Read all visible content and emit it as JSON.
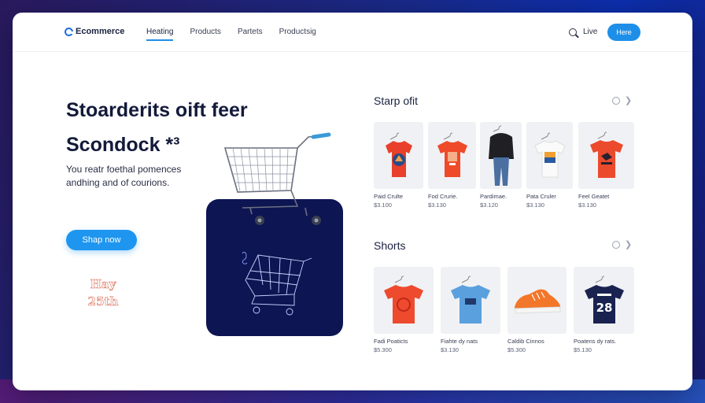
{
  "header": {
    "logo_text": "Ecommerce",
    "nav": [
      "Heating",
      "Products",
      "Partets",
      "Productsig"
    ],
    "active_nav": 0,
    "link": "Live",
    "button": "Here"
  },
  "hero": {
    "title_line1": "Stoarderits oift feer",
    "title_line2": "Scondock *³",
    "subtitle": "You reatr foethal pomences andhing and of courions.",
    "cta": "Shap now",
    "stamp_line1": "Hay",
    "stamp_line2": "25th"
  },
  "sections": [
    {
      "title": "Starp ofit",
      "products": [
        {
          "name": "Paid Crulte",
          "price": "$3.100",
          "icon": "red-graphic-tshirt"
        },
        {
          "name": "Fod Crurie.",
          "price": "$3.130",
          "icon": "orange-print-tshirt"
        },
        {
          "name": "Pardimae.",
          "price": "$3.120",
          "icon": "black-hoodie-jeans"
        },
        {
          "name": "Pata Cruler",
          "price": "$3.130",
          "icon": "white-photo-tshirt"
        },
        {
          "name": "Feel Geatet",
          "price": "$3.130",
          "icon": "red-bird-tshirt"
        }
      ]
    },
    {
      "title": "Shorts",
      "products": [
        {
          "name": "Fadi Poaticts",
          "price": "$5.300",
          "icon": "red-round-logo-tshirt"
        },
        {
          "name": "Fiahte dy nats",
          "price": "$3.130",
          "icon": "blue-print-tshirt"
        },
        {
          "name": "Caldib Cinnos",
          "price": "$5.300",
          "icon": "orange-sneaker"
        },
        {
          "name": "Poatens dy rats.",
          "price": "$5.130",
          "icon": "navy-28-jersey"
        }
      ]
    }
  ],
  "colors": {
    "accent": "#1e8fe8",
    "navy": "#0d1553",
    "title": "#131a3a"
  }
}
